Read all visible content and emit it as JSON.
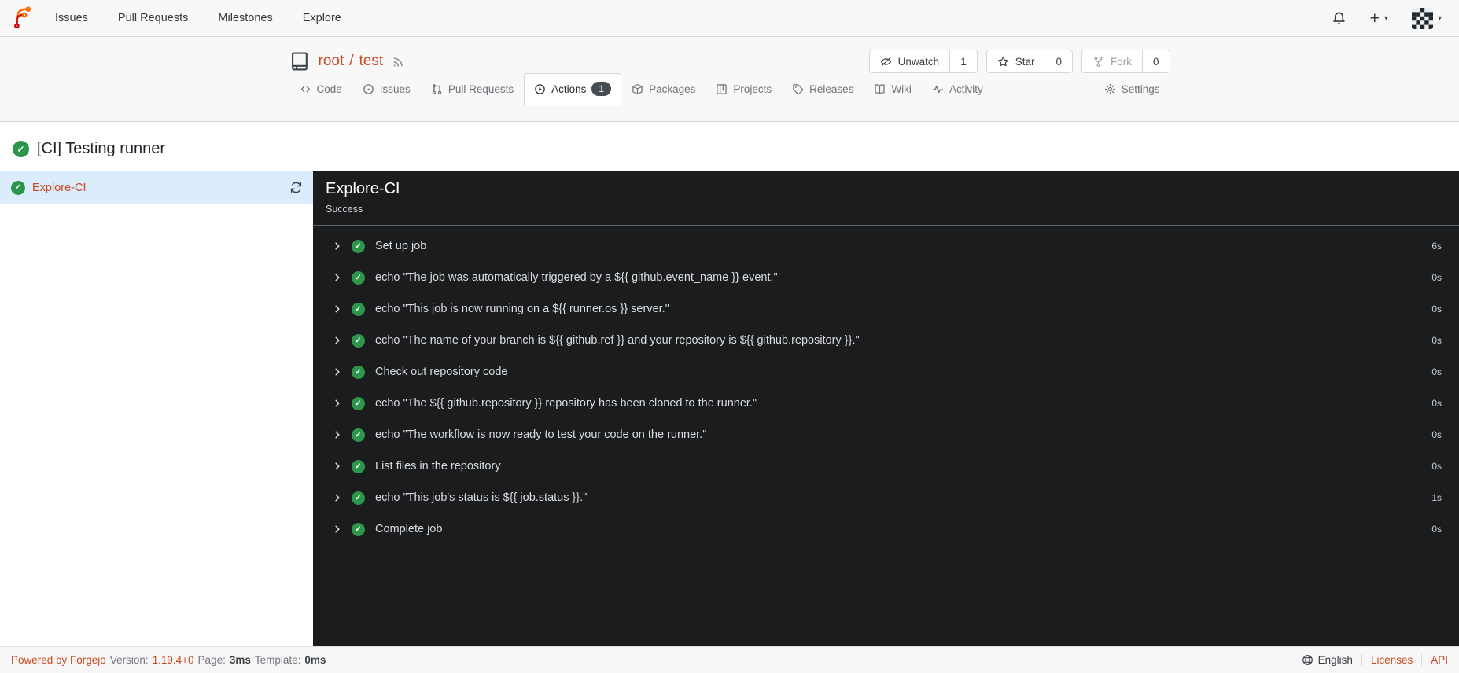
{
  "icons": {
    "check": "✓",
    "plus": "+",
    "caret": "▾"
  },
  "navbar": {
    "links": [
      {
        "label": "Issues"
      },
      {
        "label": "Pull Requests"
      },
      {
        "label": "Milestones"
      },
      {
        "label": "Explore"
      }
    ]
  },
  "repo": {
    "owner": "root",
    "slash": "/",
    "name": "test",
    "buttons": [
      {
        "label": "Unwatch",
        "count": "1"
      },
      {
        "label": "Star",
        "count": "0"
      },
      {
        "label": "Fork",
        "count": "0"
      }
    ]
  },
  "tabs": {
    "code": "Code",
    "issues": "Issues",
    "pulls": "Pull Requests",
    "actions": "Actions",
    "actions_count": "1",
    "packages": "Packages",
    "projects": "Projects",
    "releases": "Releases",
    "wiki": "Wiki",
    "activity": "Activity",
    "settings": "Settings"
  },
  "run": {
    "title": "[CI] Testing runner"
  },
  "sidebar": {
    "job_label": "Explore-CI"
  },
  "panel": {
    "title": "Explore-CI",
    "status": "Success",
    "steps": [
      {
        "name": "Set up job",
        "duration": "6s"
      },
      {
        "name": "echo \"The job was automatically triggered by a ${{ github.event_name }} event.\"",
        "duration": "0s"
      },
      {
        "name": "echo \"This job is now running on a ${{ runner.os }} server.\"",
        "duration": "0s"
      },
      {
        "name": "echo \"The name of your branch is ${{ github.ref }} and your repository is ${{ github.repository }}.\"",
        "duration": "0s"
      },
      {
        "name": "Check out repository code",
        "duration": "0s"
      },
      {
        "name": "echo \"The ${{ github.repository }} repository has been cloned to the runner.\"",
        "duration": "0s"
      },
      {
        "name": "echo \"The workflow is now ready to test your code on the runner.\"",
        "duration": "0s"
      },
      {
        "name": "List files in the repository",
        "duration": "0s"
      },
      {
        "name": "echo \"This job's status is ${{ job.status }}.\"",
        "duration": "1s"
      },
      {
        "name": "Complete job",
        "duration": "0s"
      }
    ]
  },
  "footer": {
    "powered": "Powered by Forgejo",
    "version_label": "Version:",
    "version": "1.19.4+0",
    "page_label": "Page:",
    "page_time": "3ms",
    "template_label": "Template:",
    "template_time": "0ms",
    "language": "English",
    "licenses": "Licenses",
    "api": "API"
  },
  "colors": {
    "accent": "#c9481f",
    "success_green": "#2c974b",
    "selected_row_bg": "#dbecfd",
    "panel_bg": "#1b1c1d"
  }
}
